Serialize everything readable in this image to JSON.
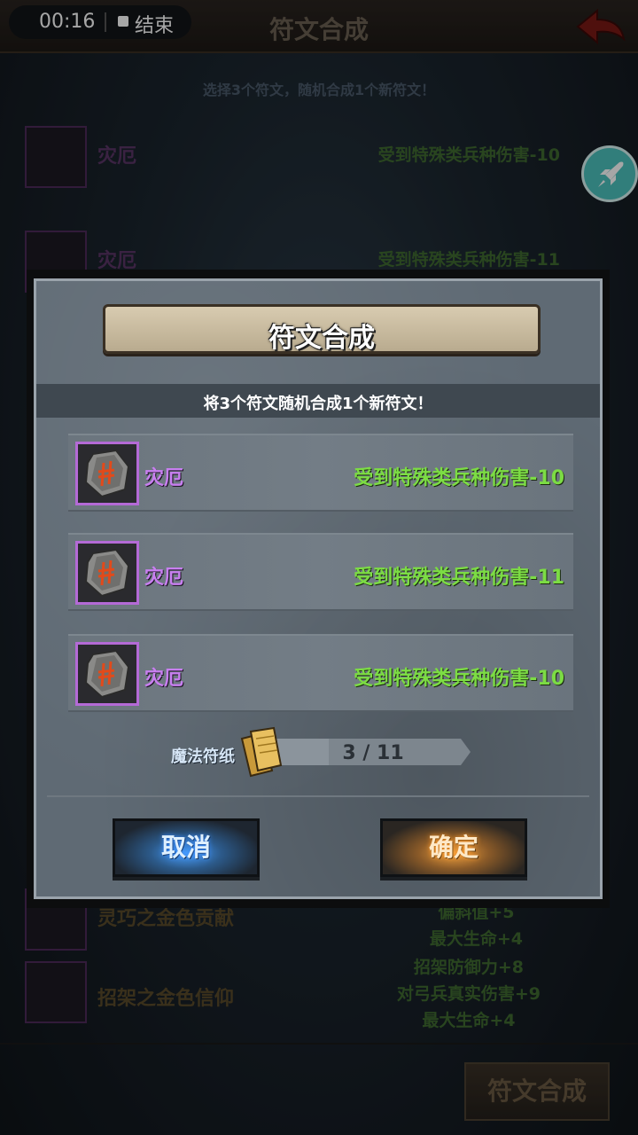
{
  "status_bar": {
    "time": "00:16",
    "end_label": "结束"
  },
  "background": {
    "title": "符文合成",
    "subtitle": "选择3个符文，随机合成1个新符文！",
    "rows": [
      {
        "name": "灾厄",
        "effect": "受到特殊类兵种伤害-10"
      },
      {
        "name": "灾厄",
        "effect": "受到特殊类兵种伤害-11"
      }
    ],
    "lower_rows": [
      {
        "name": "灵巧之金色贡献",
        "effects": [
          "偏斜值+5",
          "最大生命+4"
        ]
      },
      {
        "name": "招架之金色信仰",
        "effects": [
          "招架防御力+8",
          "对弓兵真实伤害+9",
          "最大生命+4"
        ]
      }
    ],
    "combine_button": "符文合成"
  },
  "dialog": {
    "title": "符文合成",
    "subtitle": "将3个符文随机合成1个新符文！",
    "runes": [
      {
        "name": "灾厄",
        "effect": "受到特殊类兵种伤害-10",
        "icon": "rune-stone-icon"
      },
      {
        "name": "灾厄",
        "effect": "受到特殊类兵种伤害-11",
        "icon": "rune-stone-icon"
      },
      {
        "name": "灾厄",
        "effect": "受到特殊类兵种伤害-10",
        "icon": "rune-stone-icon"
      }
    ],
    "magic_paper": {
      "label": "魔法符纸",
      "count": "3 / 11",
      "current": 3,
      "max": 11
    },
    "cancel_label": "取消",
    "confirm_label": "确定"
  },
  "colors": {
    "rune_name": "#c87ff0",
    "rune_effect": "#7cdc44",
    "rune_border": "#b46ad6",
    "accent_rocket": "#4cc2bd"
  }
}
